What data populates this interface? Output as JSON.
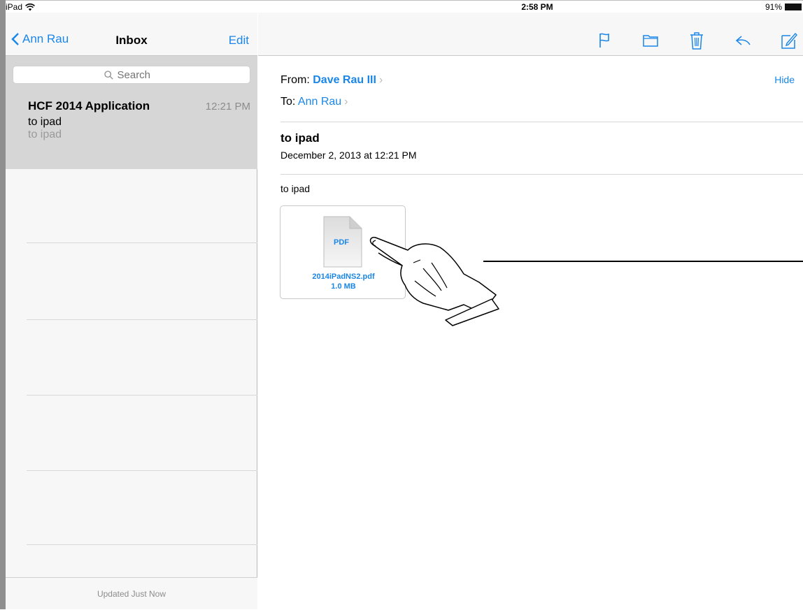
{
  "status_bar": {
    "device": "iPad",
    "time": "2:58 PM",
    "battery": "91%",
    "wifi_icon": "wifi-icon",
    "battery_icon": "battery-icon"
  },
  "mailbox": {
    "back_label": "Ann Rau",
    "title": "Inbox",
    "edit_label": "Edit",
    "search_placeholder": "Search",
    "messages": [
      {
        "sender": "HCF 2014 Application",
        "time": "12:21 PM",
        "subject": "to ipad",
        "preview": "to ipad"
      }
    ],
    "updated_text": "Updated Just Now"
  },
  "toolbar": {
    "icons": [
      "flag-icon",
      "folder-icon",
      "trash-icon",
      "reply-icon",
      "compose-icon"
    ]
  },
  "message": {
    "from_label": "From:",
    "from_name": "Dave Rau III",
    "to_label": "To:",
    "to_name": "Ann Rau",
    "hide_label": "Hide",
    "subject": "to ipad",
    "date": "December 2, 2013 at 12:21 PM",
    "body": "to ipad",
    "attachment": {
      "type_label": "PDF",
      "filename": "2014iPadNS2.pdf",
      "size": "1.0 MB"
    }
  },
  "colors": {
    "accent": "#1a86e8",
    "selected_row": "#d6d6d6",
    "muted_text": "#8c8c8c"
  }
}
